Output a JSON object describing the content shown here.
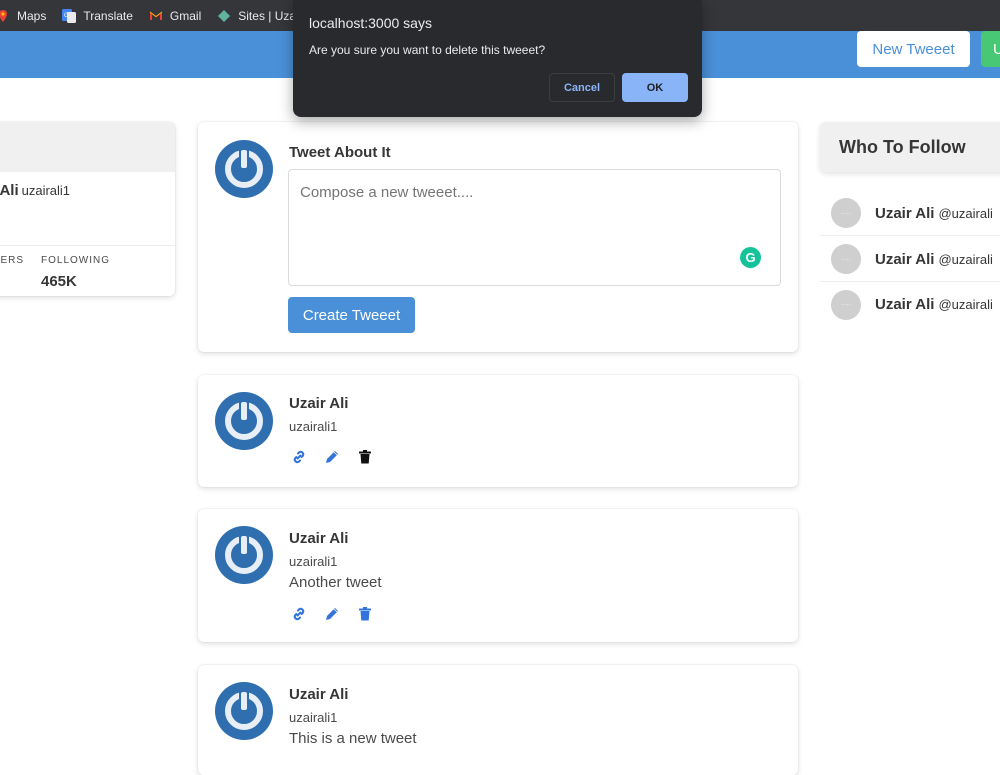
{
  "bookmarks": [
    {
      "label": "Maps",
      "icon": "maps-pin-icon"
    },
    {
      "label": "Translate",
      "icon": "translate-icon"
    },
    {
      "label": "Gmail",
      "icon": "gmail-icon"
    },
    {
      "label": "Sites | Uzai",
      "icon": "sites-icon"
    }
  ],
  "navbar": {
    "new_tweet_label": "New Tweeet",
    "user_button_label": "U",
    "accent": "#4a90d9",
    "user_button_color": "#48c774"
  },
  "profile": {
    "name": "r Ali",
    "handle": "uzairali1",
    "followers_label": "WERS",
    "following_label": "FOLLOWING",
    "following_value": "465K"
  },
  "compose": {
    "title": "Tweet About It",
    "placeholder": "Compose a new tweeet....",
    "value": "",
    "submit_label": "Create Tweeet",
    "grammarly_label": "G"
  },
  "tweets": [
    {
      "name": "Uzair Ali",
      "handle": "uzairali1",
      "text": ""
    },
    {
      "name": "Uzair Ali",
      "handle": "uzairali1",
      "text": "Another tweet"
    },
    {
      "name": "Uzair Ali",
      "handle": "uzairali1",
      "text": "This is a new tweet"
    }
  ],
  "follow": {
    "title": "Who To Follow",
    "users": [
      {
        "name": "Uzair Ali",
        "handle": "@uzairali",
        "avatar_text": "····"
      },
      {
        "name": "Uzair Ali",
        "handle": "@uzairali",
        "avatar_text": "····"
      },
      {
        "name": "Uzair Ali",
        "handle": "@uzairali",
        "avatar_text": "····"
      }
    ]
  },
  "dialog": {
    "title": "localhost:3000 says",
    "message": "Are you sure you want to delete this tweeet?",
    "cancel_label": "Cancel",
    "ok_label": "OK"
  }
}
